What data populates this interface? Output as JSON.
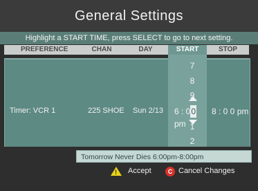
{
  "header": {
    "title": "General Settings",
    "hint": "Highlight a START TIME, press SELECT to go to next setting."
  },
  "columns": {
    "preference": "PREFERENCE",
    "chan": "CHAN",
    "day": "DAY",
    "start": "START",
    "stop": "STOP"
  },
  "row": {
    "preference": "Timer: VCR 1",
    "chan": "225 SHOE",
    "day": "Sun 2/13",
    "start_prefix": "6 : 0",
    "start_selected": "0",
    "start_suffix": "pm",
    "stop": "8 : 0 0 pm"
  },
  "start_picker": {
    "above": [
      "7",
      "8",
      "9"
    ],
    "below": [
      "1",
      "2"
    ]
  },
  "program": {
    "info": "Tomorrow Never Dies  6:00pm-8:00pm"
  },
  "footer": {
    "accept_label": "Accept",
    "cancel_label": "Cancel Changes",
    "accept_icon": "yellow-triangle-icon",
    "cancel_icon": "red-circle-icon"
  },
  "colors": {
    "accent_teal": "#5d8a83",
    "accept_yellow": "#e8d21a",
    "cancel_red": "#d7322b"
  }
}
